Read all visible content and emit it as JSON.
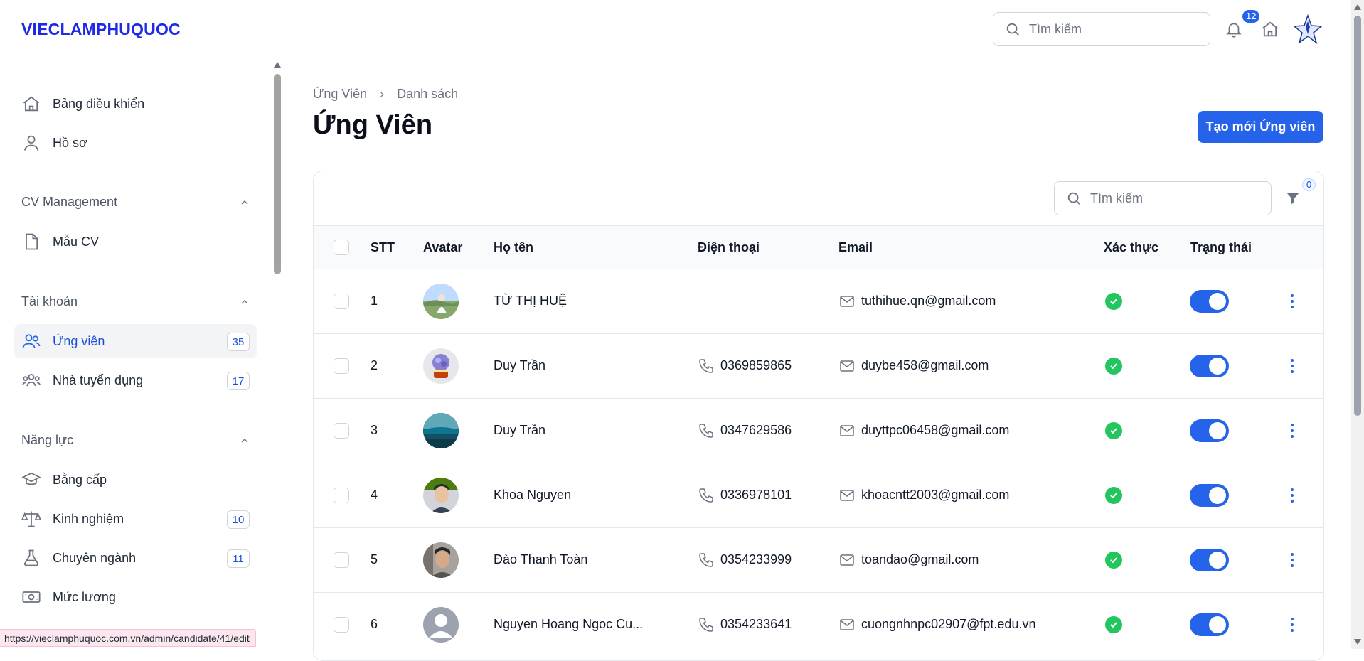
{
  "app": {
    "brand": "VIECLAMPHUQUOC"
  },
  "header": {
    "search_placeholder": "Tìm kiếm",
    "notification_count": "12"
  },
  "sidebar": {
    "items_top": [
      {
        "label": "Bảng điều khiển",
        "icon": "home-icon"
      },
      {
        "label": "Hồ sơ",
        "icon": "user-icon"
      }
    ],
    "groups": [
      {
        "label": "CV Management",
        "items": [
          {
            "label": "Mẫu CV",
            "icon": "file-icon"
          }
        ]
      },
      {
        "label": "Tài khoản",
        "items": [
          {
            "label": "Ứng viên",
            "icon": "users-icon",
            "badge": "35",
            "active": true
          },
          {
            "label": "Nhà tuyển dụng",
            "icon": "group-icon",
            "badge": "17"
          }
        ]
      },
      {
        "label": "Năng lực",
        "items": [
          {
            "label": "Bằng cấp",
            "icon": "graduation-cap-icon"
          },
          {
            "label": "Kinh nghiệm",
            "icon": "scale-icon",
            "badge": "10"
          },
          {
            "label": "Chuyên ngành",
            "icon": "flask-icon",
            "badge": "11"
          },
          {
            "label": "Mức lương",
            "icon": "money-icon"
          }
        ]
      }
    ]
  },
  "main": {
    "breadcrumb": [
      "Ứng Viên",
      "Danh sách"
    ],
    "title": "Ứng Viên",
    "create_button": "Tạo mới Ứng viên",
    "table_search_placeholder": "Tìm kiếm",
    "filter_count": "0",
    "columns": [
      "STT",
      "Avatar",
      "Họ tên",
      "Điện thoại",
      "Email",
      "Xác thực",
      "Trạng thái"
    ],
    "rows": [
      {
        "stt": "1",
        "name": "TỪ THỊ HUỆ",
        "phone": "",
        "email": "tuthihue.qn@gmail.com",
        "verified": true,
        "active": true
      },
      {
        "stt": "2",
        "name": "Duy Trần",
        "phone": "0369859865",
        "email": "duybe458@gmail.com",
        "verified": true,
        "active": true
      },
      {
        "stt": "3",
        "name": "Duy Trần",
        "phone": "0347629586",
        "email": "duyttpc06458@gmail.com",
        "verified": true,
        "active": true
      },
      {
        "stt": "4",
        "name": "Khoa Nguyen",
        "phone": "0336978101",
        "email": "khoacntt2003@gmail.com",
        "verified": true,
        "active": true
      },
      {
        "stt": "5",
        "name": "Đào Thanh Toàn",
        "phone": "0354233999",
        "email": "toandao@gmail.com",
        "verified": true,
        "active": true
      },
      {
        "stt": "6",
        "name": "Nguyen Hoang Ngoc Cu...",
        "phone": "0354233641",
        "email": "cuongnhnpc02907@fpt.edu.vn",
        "verified": true,
        "active": true
      }
    ]
  },
  "status_bar": {
    "url": "https://vieclamphuquoc.com.vn/admin/candidate/41/edit"
  },
  "colors": {
    "brand": "#1d28e8",
    "primary": "#2563eb",
    "success": "#22c55e"
  }
}
